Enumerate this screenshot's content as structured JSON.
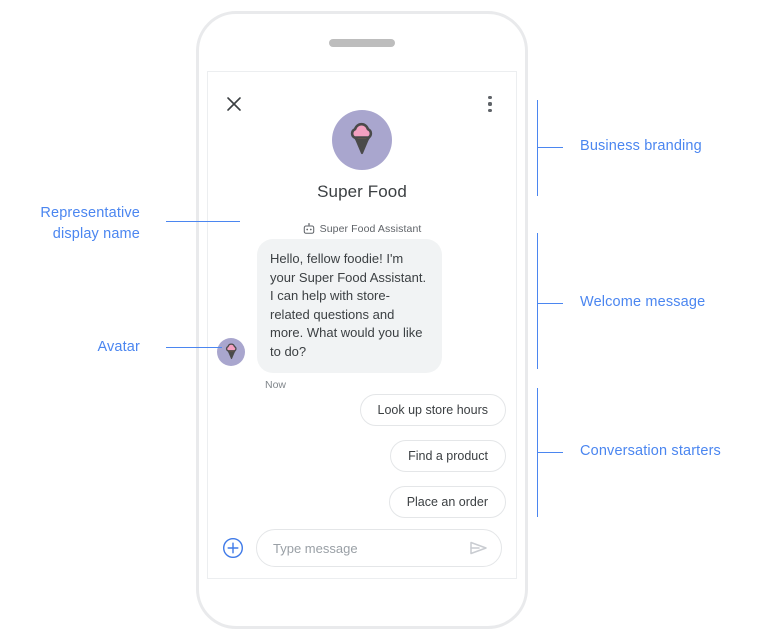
{
  "phone": {
    "speaker_grille": "speaker-grille"
  },
  "chat": {
    "header": {
      "close_icon": "close-icon",
      "menu_icon": "more-vertical-icon"
    },
    "branding": {
      "logo_icon": "ice-cream-cone-logo",
      "business_name": "Super Food",
      "logo_circle_color": "#a9a6ce",
      "scoop_color": "#f4a0c0",
      "cone_color": "#c07a3e",
      "outline_color": "#4a4a4a"
    },
    "representative": {
      "bot_icon": "bot-face-icon",
      "display_name": "Super Food Assistant"
    },
    "message": {
      "avatar_icon": "ice-cream-cone-avatar",
      "text": "Hello, fellow foodie! I'm your Super Food Assistant. I can help with store-related questions and more. What would you like to do?",
      "timestamp": "Now",
      "bubble_color": "#f1f3f4"
    },
    "starters": [
      {
        "label": "Look up store hours"
      },
      {
        "label": "Find a product"
      },
      {
        "label": "Place an order"
      }
    ],
    "composer": {
      "plus_icon": "add-circle-icon",
      "plus_color": "#3f7ae8",
      "input_value": "",
      "input_placeholder": "Type message",
      "send_icon": "send-icon"
    }
  },
  "annotations": {
    "accent_color": "#4b86f0",
    "right": [
      {
        "label": "Business branding"
      },
      {
        "label": "Welcome message"
      },
      {
        "label": "Conversation starters"
      }
    ],
    "left": [
      {
        "label": "Representative\ndisplay name"
      },
      {
        "label": "Avatar"
      }
    ]
  }
}
